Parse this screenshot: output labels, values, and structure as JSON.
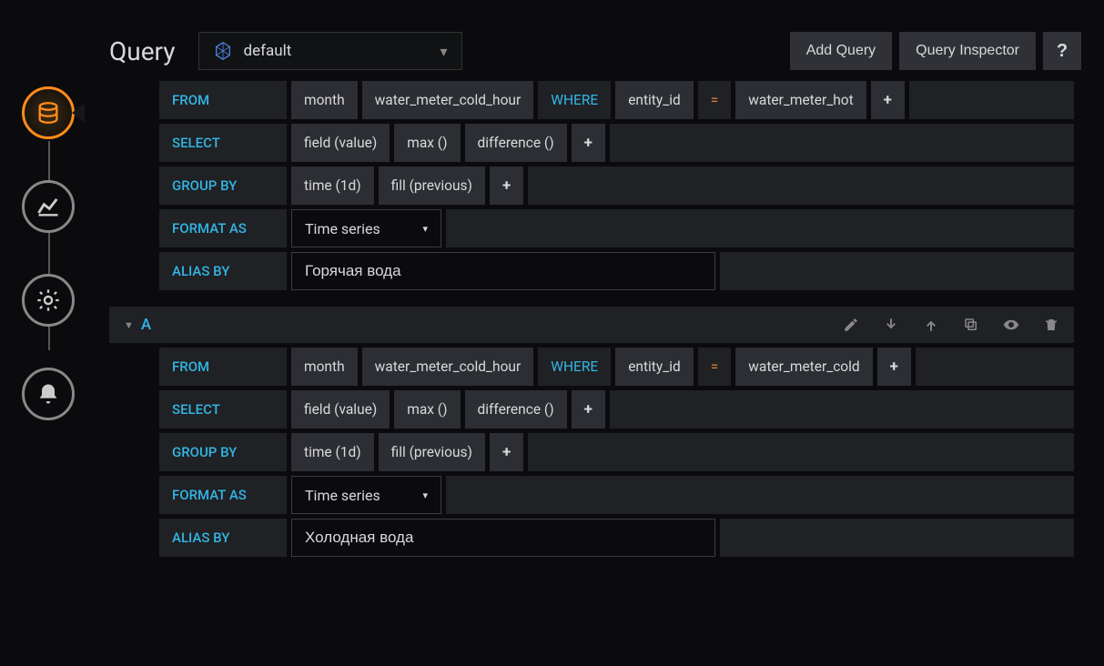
{
  "header": {
    "title": "Query",
    "datasource": "default",
    "add_query_btn": "Add Query",
    "inspector_btn": "Query Inspector",
    "help_btn": "?"
  },
  "sidebar": {
    "items": [
      {
        "name": "datasource",
        "active": true
      },
      {
        "name": "visualization",
        "active": false
      },
      {
        "name": "settings",
        "active": false
      },
      {
        "name": "alert",
        "active": false
      }
    ]
  },
  "labels": {
    "from": "FROM",
    "select": "SELECT",
    "group_by": "GROUP BY",
    "format_as": "FORMAT AS",
    "alias_by": "ALIAS BY",
    "where": "WHERE",
    "plus": "+",
    "eq": "="
  },
  "queries": [
    {
      "letter": "",
      "show_header": false,
      "from": {
        "retention": "month",
        "measurement": "water_meter_cold_hour",
        "where_field": "entity_id",
        "where_value": "water_meter_hot"
      },
      "select": [
        "field (value)",
        "max ()",
        "difference ()"
      ],
      "group_by": [
        "time (1d)",
        "fill (previous)"
      ],
      "format": "Time series",
      "alias": "Горячая вода"
    },
    {
      "letter": "A",
      "show_header": true,
      "from": {
        "retention": "month",
        "measurement": "water_meter_cold_hour",
        "where_field": "entity_id",
        "where_value": "water_meter_cold"
      },
      "select": [
        "field (value)",
        "max ()",
        "difference ()"
      ],
      "group_by": [
        "time (1d)",
        "fill (previous)"
      ],
      "format": "Time series",
      "alias": "Холодная вода"
    }
  ]
}
